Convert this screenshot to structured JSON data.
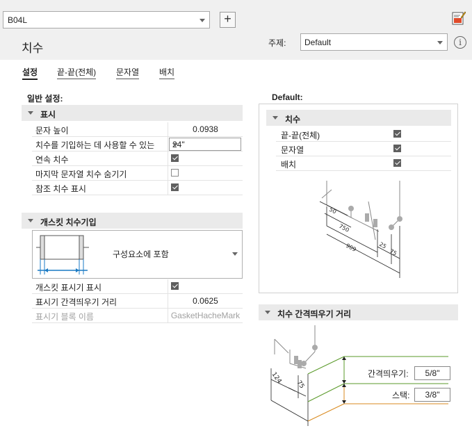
{
  "header": {
    "style_name": "B04L",
    "add_label": "+",
    "page_title": "치수",
    "subject_label": "주제:",
    "subject_value": "Default",
    "info_glyph": "i"
  },
  "tabs": [
    {
      "label": "설정",
      "active": true
    },
    {
      "label": "끝-끝(전체)",
      "active": false
    },
    {
      "label": "문자열",
      "active": false
    },
    {
      "label": "배치",
      "active": false
    }
  ],
  "general": {
    "heading": "일반 설정:",
    "display_group": {
      "label": "표시",
      "rows": [
        {
          "name": "문자 높이",
          "value": "0.0938"
        },
        {
          "name": "치수를 기입하는 데 사용할 수 있는",
          "value": "24\""
        },
        {
          "name": "연속 치수",
          "checked": true
        },
        {
          "name": "마지막 문자열 치수 숨기기",
          "checked": false
        },
        {
          "name": "참조 치수 표시",
          "checked": true
        }
      ]
    },
    "gasket_group": {
      "label": "개스킷 치수기입",
      "option": "구성요소에 포함",
      "rows": [
        {
          "name": "개스킷 표시기 표시",
          "checked": true
        },
        {
          "name": "표시기 간격띄우기 거리",
          "value": "0.0625"
        },
        {
          "name": "표시기 블록 이름",
          "value": "GasketHacheMark",
          "disabled": true
        }
      ]
    }
  },
  "default_panel": {
    "heading": "Default:",
    "group_label": "치수",
    "rows": [
      {
        "name": "끝-끝(전체)",
        "checked": true
      },
      {
        "name": "문자열",
        "checked": true
      },
      {
        "name": "배치",
        "checked": true
      }
    ],
    "diagram_labels": [
      "50",
      "750",
      "909",
      "25",
      "75"
    ]
  },
  "spacing_section": {
    "label": "치수 간격띄우기 거리",
    "spacing_label": "간격띄우기:",
    "spacing_value": "5/8\"",
    "stack_label": "스택:",
    "stack_value": "3/8\"",
    "diagram_labels": [
      "124",
      "75"
    ]
  },
  "colors": {
    "accent_blue": "#1a7ac4",
    "green_line": "#5a9a2a",
    "orange_line": "#d98a1f"
  }
}
